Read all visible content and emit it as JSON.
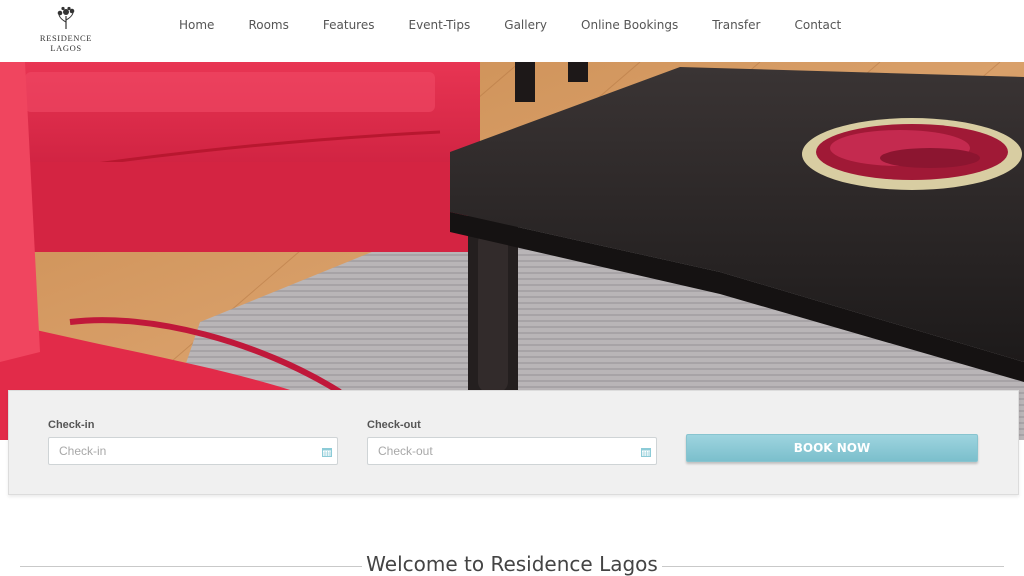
{
  "brand": {
    "name": "RESIDENCE LAGOS"
  },
  "nav": {
    "items": [
      {
        "label": "Home"
      },
      {
        "label": "Rooms"
      },
      {
        "label": "Features"
      },
      {
        "label": "Event-Tips"
      },
      {
        "label": "Gallery"
      },
      {
        "label": "Online Bookings"
      },
      {
        "label": "Transfer"
      },
      {
        "label": "Contact"
      }
    ]
  },
  "booking": {
    "checkin_label": "Check-in",
    "checkin_placeholder": "Check-in",
    "checkout_label": "Check-out",
    "checkout_placeholder": "Check-out",
    "button_label": "BOOK NOW",
    "icon": "calendar-icon",
    "accent_color": "#8ccbd7"
  },
  "welcome": {
    "title": "Welcome to Residence Lagos"
  }
}
